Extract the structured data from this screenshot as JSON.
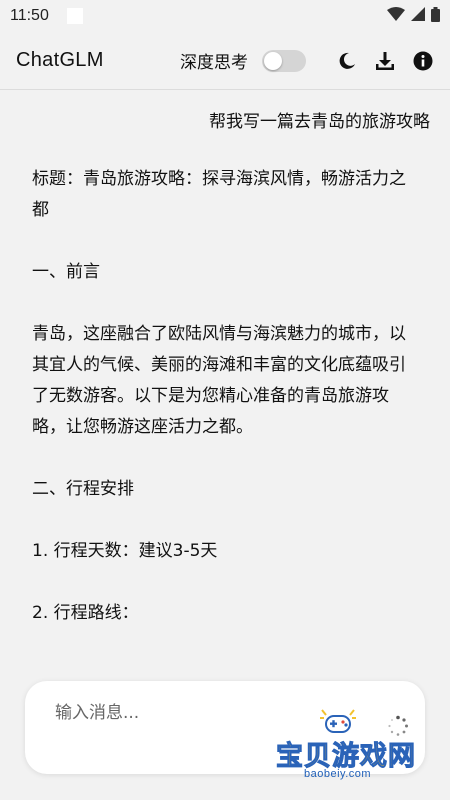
{
  "status_bar": {
    "time": "11:50",
    "icons": [
      "wifi-icon",
      "cellular-signal-icon",
      "battery-icon"
    ]
  },
  "header": {
    "title": "ChatGLM",
    "deep_thinking_label": "深度思考",
    "deep_thinking_enabled": false,
    "icons": [
      "moon-icon",
      "download-icon",
      "info-icon"
    ]
  },
  "chat": {
    "user_message": "帮我写一篇去青岛的旅游攻略",
    "reply_paragraphs": [
      "标题：青岛旅游攻略：探寻海滨风情，畅游活力之都",
      "一、前言",
      "青岛，这座融合了欧陆风情与海滨魅力的城市，以其宜人的气候、美丽的海滩和丰富的文化底蕴吸引了无数游客。以下是为您精心准备的青岛旅游攻略，让您畅游这座活力之都。",
      "二、行程安排",
      "1. 行程天数：建议3-5天",
      "2. 行程路线："
    ]
  },
  "input": {
    "placeholder": "输入消息..."
  },
  "watermark": {
    "main": "宝贝游戏网",
    "sub": "baobeiy.com"
  },
  "colors": {
    "background": "#f2f2f2",
    "toggle_off": "#d5d5d5",
    "watermark_yellow": "#f2c230",
    "watermark_blue": "#2a63b8"
  }
}
